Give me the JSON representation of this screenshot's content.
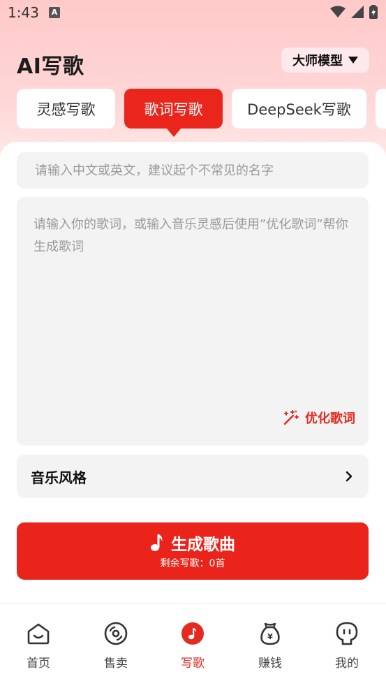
{
  "status": {
    "time": "1:43",
    "notification_glyph": "A"
  },
  "header": {
    "title": "AI写歌",
    "model_label": "大师模型"
  },
  "tabs": [
    {
      "label": "灵感写歌",
      "active": false
    },
    {
      "label": "歌词写歌",
      "active": true
    },
    {
      "label": "DeepSeek写歌",
      "active": false
    }
  ],
  "form": {
    "name_placeholder": "请输入中文或英文，建议起个不常见的名字",
    "name_value": "",
    "lyrics_placeholder": "请输入你的歌词，或输入音乐灵感后使用”优化歌词”帮你生成歌词",
    "lyrics_value": "",
    "optimize_label": "优化歌词",
    "style_label": "音乐风格"
  },
  "generate": {
    "label": "生成歌曲",
    "remaining": "剩余写歌：0首"
  },
  "nav": [
    {
      "label": "首页",
      "icon": "home-icon"
    },
    {
      "label": "售卖",
      "icon": "disc-icon"
    },
    {
      "label": "写歌",
      "icon": "music-note-icon",
      "active": true
    },
    {
      "label": "赚钱",
      "icon": "money-bag-icon"
    },
    {
      "label": "我的",
      "icon": "profile-icon"
    }
  ],
  "colors": {
    "accent": "#EA251C",
    "background_top": "#FFC9C9",
    "field_bg": "#F3F3F3"
  }
}
